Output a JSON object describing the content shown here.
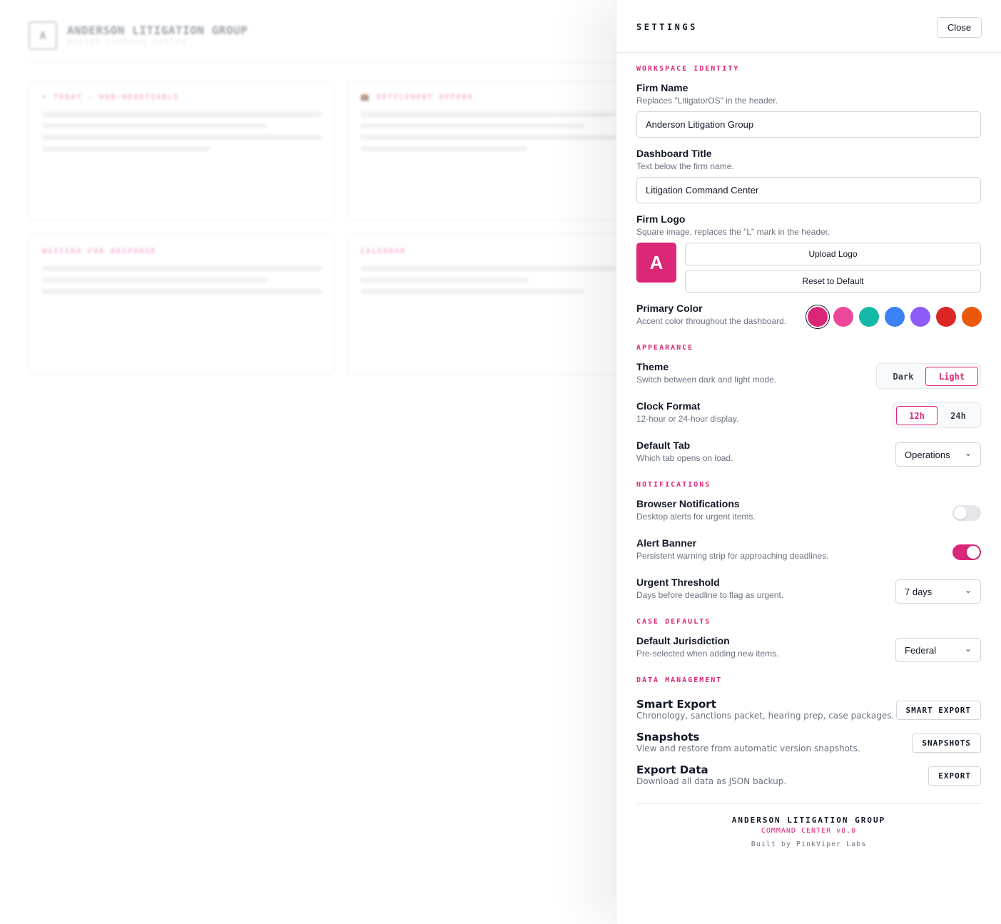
{
  "background": {
    "logo_letter": "A",
    "firm_name": "ANDERSON LITIGATION GROUP",
    "subtitle": "MASTER COMMAND CENTER",
    "cards": [
      {
        "title": "• TODAY · NON-NEGOTIABLE"
      },
      {
        "title": "💼 SETTLEMENT OFFERS"
      },
      {
        "title": "WAITING FOR RESPONSE"
      },
      {
        "title": "CALENDAR"
      }
    ]
  },
  "settings": {
    "title": "SETTINGS",
    "close_label": "Close",
    "sections": {
      "workspace": "WORKSPACE IDENTITY",
      "appearance": "APPEARANCE",
      "notifications": "NOTIFICATIONS",
      "case_defaults": "CASE DEFAULTS",
      "data_management": "DATA MANAGEMENT"
    },
    "firm_name": {
      "label": "Firm Name",
      "help": "Replaces \"LitigatorOS\" in the header.",
      "value": "Anderson Litigation Group"
    },
    "dashboard_title": {
      "label": "Dashboard Title",
      "help": "Text below the firm name.",
      "value": "Litigation Command Center"
    },
    "firm_logo": {
      "label": "Firm Logo",
      "help": "Square image, replaces the \"L\" mark in the header.",
      "preview_letter": "A",
      "upload_label": "Upload Logo",
      "reset_label": "Reset to Default"
    },
    "primary_color": {
      "label": "Primary Color",
      "help": "Accent color throughout the dashboard.",
      "swatches": [
        "#db2777",
        "#ec4899",
        "#14b8a6",
        "#3b82f6",
        "#8b5cf6",
        "#dc2626",
        "#ea580c"
      ],
      "selected": "#db2777"
    },
    "theme": {
      "label": "Theme",
      "help": "Switch between dark and light mode.",
      "options": [
        "Dark",
        "Light"
      ],
      "selected": "Light"
    },
    "clock_format": {
      "label": "Clock Format",
      "help": "12-hour or 24-hour display.",
      "options": [
        "12h",
        "24h"
      ],
      "selected": "12h"
    },
    "default_tab": {
      "label": "Default Tab",
      "help": "Which tab opens on load.",
      "value": "Operations"
    },
    "browser_notifications": {
      "label": "Browser Notifications",
      "help": "Desktop alerts for urgent items.",
      "enabled": false
    },
    "alert_banner": {
      "label": "Alert Banner",
      "help": "Persistent warning strip for approaching deadlines.",
      "enabled": true
    },
    "urgent_threshold": {
      "label": "Urgent Threshold",
      "help": "Days before deadline to flag as urgent.",
      "value": "7 days"
    },
    "default_jurisdiction": {
      "label": "Default Jurisdiction",
      "help": "Pre-selected when adding new items.",
      "value": "Federal"
    },
    "smart_export": {
      "label": "Smart Export",
      "help": "Chronology, sanctions packet, hearing prep, case packages.",
      "button": "SMART EXPORT"
    },
    "snapshots": {
      "label": "Snapshots",
      "help": "View and restore from automatic version snapshots.",
      "button": "SNAPSHOTS"
    },
    "export_data": {
      "label": "Export Data",
      "help": "Download all data as JSON backup.",
      "button": "EXPORT"
    },
    "footer": {
      "firm": "ANDERSON LITIGATION GROUP",
      "version": "COMMAND CENTER v8.0",
      "credit": "Built by PinkViper Labs"
    },
    "colors": {
      "accent": "#db2777",
      "text": "#111827",
      "muted": "#6b7280",
      "border": "#d1d5db"
    }
  }
}
